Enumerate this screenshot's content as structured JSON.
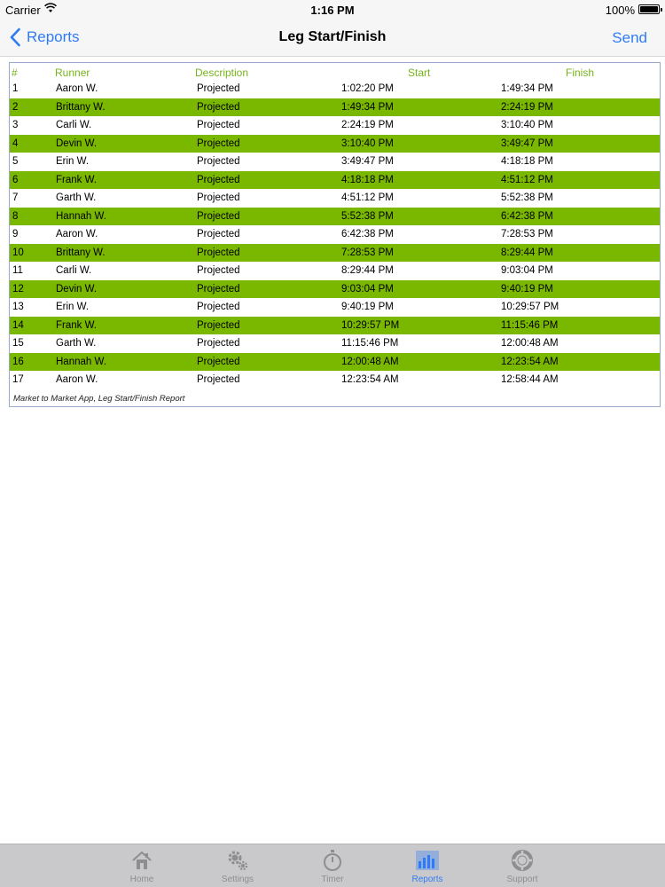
{
  "status_bar": {
    "carrier": "Carrier",
    "time": "1:16 PM",
    "battery": "100%"
  },
  "nav": {
    "back_label": "Reports",
    "title": "Leg Start/Finish",
    "send_label": "Send"
  },
  "report": {
    "headers": {
      "num": "#",
      "runner": "Runner",
      "description": "Description",
      "start": "Start",
      "finish": "Finish"
    },
    "rows": [
      {
        "num": "1",
        "runner": "Aaron W.",
        "description": "Projected",
        "start": "1:02:20 PM",
        "finish": "1:49:34 PM"
      },
      {
        "num": "2",
        "runner": "Brittany W.",
        "description": "Projected",
        "start": "1:49:34 PM",
        "finish": "2:24:19 PM"
      },
      {
        "num": "3",
        "runner": "Carli W.",
        "description": "Projected",
        "start": "2:24:19 PM",
        "finish": "3:10:40 PM"
      },
      {
        "num": "4",
        "runner": "Devin W.",
        "description": "Projected",
        "start": "3:10:40 PM",
        "finish": "3:49:47 PM"
      },
      {
        "num": "5",
        "runner": "Erin W.",
        "description": "Projected",
        "start": "3:49:47 PM",
        "finish": "4:18:18 PM"
      },
      {
        "num": "6",
        "runner": "Frank W.",
        "description": "Projected",
        "start": "4:18:18 PM",
        "finish": "4:51:12 PM"
      },
      {
        "num": "7",
        "runner": "Garth W.",
        "description": "Projected",
        "start": "4:51:12 PM",
        "finish": "5:52:38 PM"
      },
      {
        "num": "8",
        "runner": "Hannah W.",
        "description": "Projected",
        "start": "5:52:38 PM",
        "finish": "6:42:38 PM"
      },
      {
        "num": "9",
        "runner": "Aaron W.",
        "description": "Projected",
        "start": "6:42:38 PM",
        "finish": "7:28:53 PM"
      },
      {
        "num": "10",
        "runner": "Brittany W.",
        "description": "Projected",
        "start": "7:28:53 PM",
        "finish": "8:29:44 PM"
      },
      {
        "num": "11",
        "runner": "Carli W.",
        "description": "Projected",
        "start": "8:29:44 PM",
        "finish": "9:03:04 PM"
      },
      {
        "num": "12",
        "runner": "Devin W.",
        "description": "Projected",
        "start": "9:03:04 PM",
        "finish": "9:40:19 PM"
      },
      {
        "num": "13",
        "runner": "Erin W.",
        "description": "Projected",
        "start": "9:40:19 PM",
        "finish": "10:29:57 PM"
      },
      {
        "num": "14",
        "runner": "Frank W.",
        "description": "Projected",
        "start": "10:29:57 PM",
        "finish": "11:15:46 PM"
      },
      {
        "num": "15",
        "runner": "Garth W.",
        "description": "Projected",
        "start": "11:15:46 PM",
        "finish": "12:00:48 AM"
      },
      {
        "num": "16",
        "runner": "Hannah W.",
        "description": "Projected",
        "start": "12:00:48 AM",
        "finish": "12:23:54 AM"
      },
      {
        "num": "17",
        "runner": "Aaron W.",
        "description": "Projected",
        "start": "12:23:54 AM",
        "finish": "12:58:44 AM"
      }
    ],
    "footer_note": "Market to Market App, Leg Start/Finish Report",
    "stripe_color": "#7ab800",
    "header_color": "#76b519"
  },
  "tabbar": {
    "tabs": [
      {
        "label": "Home",
        "icon": "home-icon",
        "active": false
      },
      {
        "label": "Settings",
        "icon": "gears-icon",
        "active": false
      },
      {
        "label": "Timer",
        "icon": "stopwatch-icon",
        "active": false
      },
      {
        "label": "Reports",
        "icon": "bar-chart-icon",
        "active": true
      },
      {
        "label": "Support",
        "icon": "lifebuoy-icon",
        "active": false
      }
    ]
  },
  "accent_color": "#2f7bf6"
}
